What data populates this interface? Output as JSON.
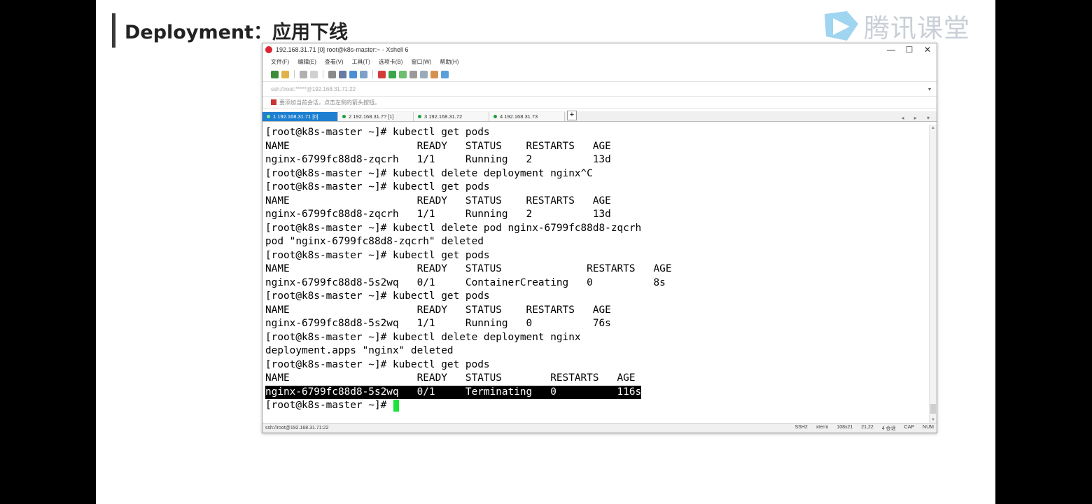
{
  "slide": {
    "title": "Deployment：应用下线",
    "brand_text": "腾讯课堂"
  },
  "window": {
    "title": "192.168.31.71 [0]   root@k8s-master:~ - Xshell 6",
    "controls": {
      "minimize": "—",
      "maximize": "☐",
      "close": "✕"
    },
    "menu": [
      "文件(F)",
      "编辑(E)",
      "查看(V)",
      "工具(T)",
      "选项卡(B)",
      "窗口(W)",
      "帮助(H)"
    ],
    "address": "ssh://root:*****@192.168.31.71:22",
    "hint": "要添加当前会话，点击左侧的箭头按钮。",
    "tabs": [
      {
        "label": "1 192.168.31.71 [0]",
        "active": true
      },
      {
        "label": "2 192.168.31.7? [1]",
        "active": false
      },
      {
        "label": "3 192.168.31.72",
        "active": false
      },
      {
        "label": "4 192.168.31.73",
        "active": false
      }
    ],
    "tab_add": "+",
    "tab_nav": "◂ ▸ ▾"
  },
  "terminal": {
    "lines": [
      "[root@k8s-master ~]# kubectl get pods",
      "NAME                     READY   STATUS    RESTARTS   AGE",
      "nginx-6799fc88d8-zqcrh   1/1     Running   2          13d",
      "[root@k8s-master ~]# kubectl delete deployment nginx^C",
      "[root@k8s-master ~]# kubectl get pods",
      "NAME                     READY   STATUS    RESTARTS   AGE",
      "nginx-6799fc88d8-zqcrh   1/1     Running   2          13d",
      "[root@k8s-master ~]# kubectl delete pod nginx-6799fc88d8-zqcrh",
      "pod \"nginx-6799fc88d8-zqcrh\" deleted",
      "[root@k8s-master ~]# kubectl get pods",
      "NAME                     READY   STATUS              RESTARTS   AGE",
      "nginx-6799fc88d8-5s2wq   0/1     ContainerCreating   0          8s",
      "[root@k8s-master ~]# kubectl get pods",
      "NAME                     READY   STATUS    RESTARTS   AGE",
      "nginx-6799fc88d8-5s2wq   1/1     Running   0          76s",
      "[root@k8s-master ~]# kubectl delete deployment nginx",
      "deployment.apps \"nginx\" deleted",
      "[root@k8s-master ~]# kubectl get pods",
      "NAME                     READY   STATUS        RESTARTS   AGE",
      "nginx-6799fc88d8-5s2wq   0/1     Terminating   0          116s",
      "[root@k8s-master ~]# "
    ],
    "highlighted_line": 19
  },
  "status": {
    "connection": "ssh://root@192.168.31.71:22",
    "protocol": "SSH2",
    "term": "xterm",
    "size": "108x21",
    "position": "21,22",
    "sessions": "4 会话",
    "cap": "CAP",
    "num": "NUM"
  },
  "colors": {
    "tab_active": "#1e7fd0",
    "cursor": "#1de23b",
    "session_dot": "#1b9e3e"
  }
}
